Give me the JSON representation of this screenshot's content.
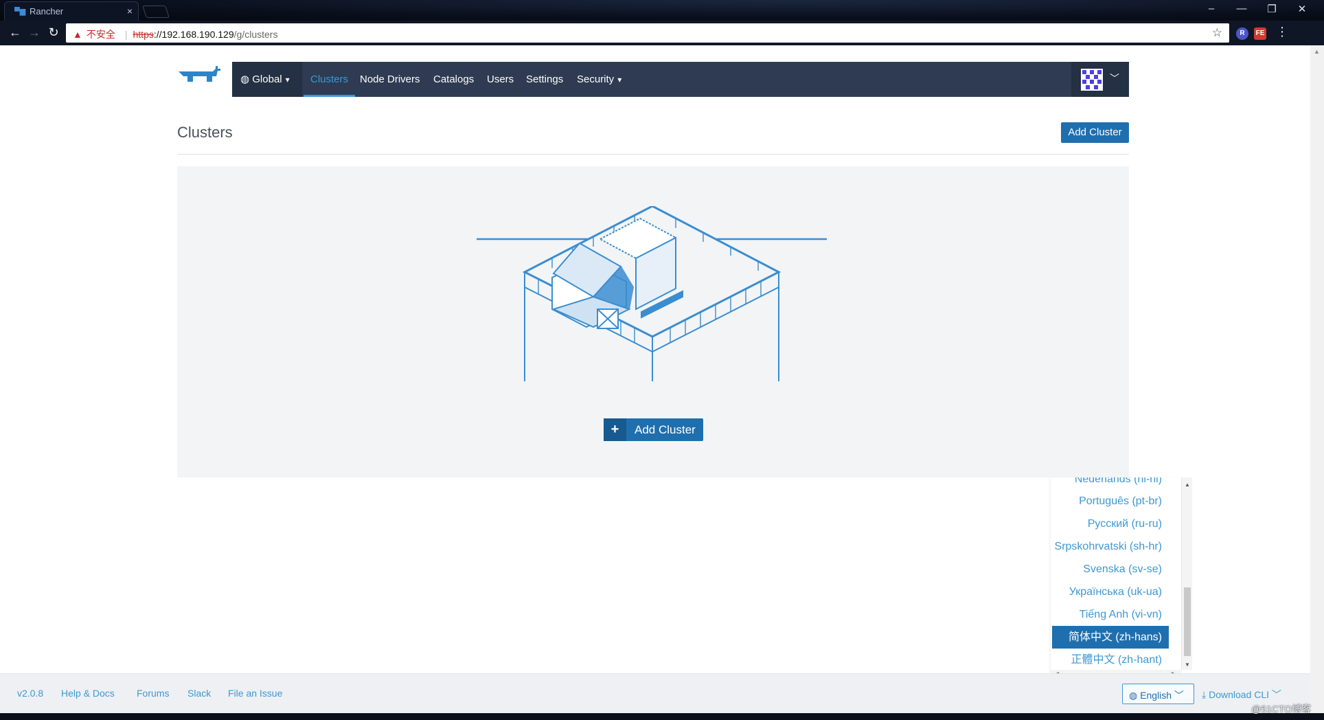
{
  "browser": {
    "tab_title": "Rancher",
    "tab_close": "×",
    "security_warning": "不安全",
    "url_scheme": "https",
    "url_host": "://192.168.190.129",
    "url_path": "/g/clusters",
    "window_controls": [
      "–",
      "—",
      "❐",
      "✕"
    ],
    "ext1": "R",
    "ext2": "FE"
  },
  "nav": {
    "global": "Global",
    "items": [
      "Clusters",
      "Node Drivers",
      "Catalogs",
      "Users",
      "Settings",
      "Security"
    ],
    "active": "Clusters"
  },
  "page": {
    "title": "Clusters",
    "add_button": "Add Cluster",
    "empty_add_button": "Add Cluster"
  },
  "language_menu": {
    "options": [
      "Nederlands (nl-nl)",
      "Português (pt-br)",
      "Русский (ru-ru)",
      "Srpskohrvatski (sh-hr)",
      "Svenska (sv-se)",
      "Українська (uk-ua)",
      "Tiếng Anh (vi-vn)",
      "简体中文 (zh-hans)",
      "正體中文 (zh-hant)"
    ],
    "selected": "简体中文 (zh-hans)"
  },
  "footer": {
    "version": "v2.0.8",
    "links": [
      "Help & Docs",
      "Forums",
      "Slack",
      "File an Issue"
    ],
    "language": "English",
    "download_cli": "Download CLI"
  },
  "watermark": "@51CTO博客",
  "colors": {
    "nav_bg": "#2e3b52",
    "accent": "#3d98d3",
    "button": "#1f6fae",
    "panel": "#f2f4f6"
  }
}
